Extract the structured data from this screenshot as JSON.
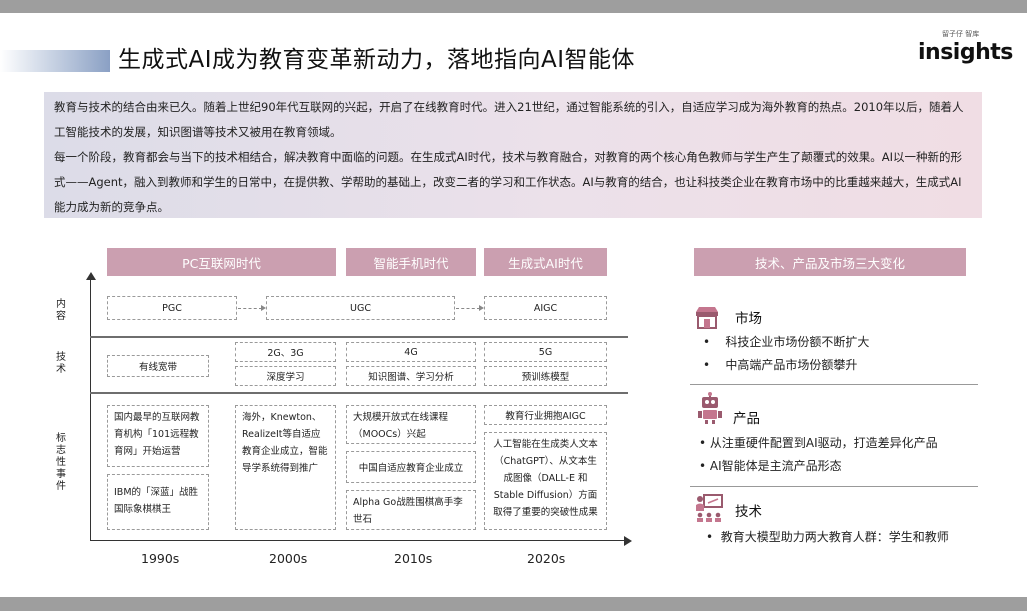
{
  "title": "生成式AI成为教育变革新动力，落地指向AI智能体",
  "logo": {
    "small": "留子仔 智库",
    "main": "insights"
  },
  "intro": {
    "p1": "教育与技术的结合由来已久。随着上世纪90年代互联网的兴起，开启了在线教育时代。进入21世纪，通过智能系统的引入，自适应学习成为海外教育的热点。2010年以后，随着人工智能技术的发展，知识图谱等技术又被用在教育领域。",
    "p2": "每一个阶段，教育都会与当下的技术相结合，解决教育中面临的问题。在生成式AI时代，技术与教育融合，对教育的两个核心角色教师与学生产生了颠覆式的效果。AI以一种新的形式——Agent，融入到教师和学生的日常中，在提供教、学帮助的基础上，改变二者的学习和工作状态。AI与教育的结合，也让科技类企业在教育市场中的比重越来越大，生成式AI能力成为新的竞争点。"
  },
  "timeline": {
    "phases": [
      "PC互联网时代",
      "智能手机时代",
      "生成式AI时代"
    ],
    "row_labels": {
      "content": "内容",
      "tech": "技术",
      "events": "标志性事件"
    },
    "content": [
      "PGC",
      "UGC",
      "AIGC"
    ],
    "tech": {
      "t1990": "有线宽带",
      "t2000a": "2G、3G",
      "t2000b": "深度学习",
      "t2010a": "4G",
      "t2010b": "知识图谱、学习分析",
      "t2020a": "5G",
      "t2020b": "预训练模型"
    },
    "events": {
      "e1990a": "国内最早的互联网教育机构「101远程教育网」开始运营",
      "e1990b": "IBM的「深蓝」战胜国际象棋棋王",
      "e2000": "海外，Knewton、RealizeIt等自适应教育企业成立，智能导学系统得到推广",
      "e2010a": "大规模开放式在线课程（MOOCs）兴起",
      "e2010b": "中国自适应教育企业成立",
      "e2010c": "Alpha Go战胜围棋高手李世石",
      "e2020a": "教育行业拥抱AIGC",
      "e2020b": "人工智能在生成类人文本（ChatGPT）、从文本生成图像（DALL-E 和 Stable Diffusion）方面取得了重要的突破性成果"
    },
    "decades": [
      "1990s",
      "2000s",
      "2010s",
      "2020s"
    ]
  },
  "right": {
    "header": "技术、产品及市场三大变化",
    "sections": [
      {
        "title": "市场",
        "icon": "storefront-icon",
        "bullets": [
          "科技企业市场份额不断扩大",
          "中高端产品市场份额攀升"
        ]
      },
      {
        "title": "产品",
        "icon": "robot-icon",
        "bullets": [
          "从注重硬件配置到AI驱动，打造差异化产品",
          "AI智能体是主流产品形态"
        ]
      },
      {
        "title": "技术",
        "icon": "teacher-icon",
        "bullets": [
          "教育大模型助力两大教育人群：学生和教师"
        ]
      }
    ]
  },
  "colors": {
    "phase_bg": "#cb9fb0",
    "bar_gray": "#9e9e9e",
    "accent_blue": "#8aa0c4"
  }
}
